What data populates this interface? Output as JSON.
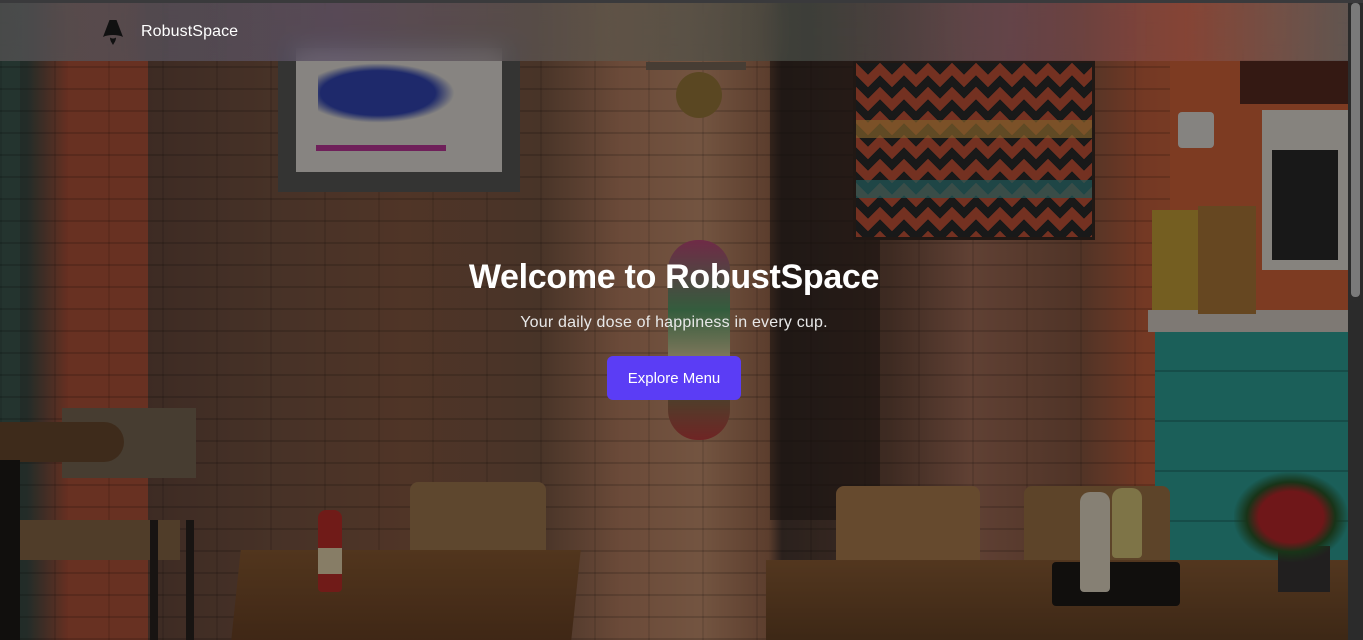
{
  "navbar": {
    "brand_name": "RobustSpace",
    "logo_icon": "astro-logo-icon"
  },
  "hero": {
    "title": "Welcome to RobustSpace",
    "subtitle": "Your daily dose of happiness in every cup.",
    "cta_label": "Explore Menu",
    "background": "cafe-interior-photo"
  },
  "colors": {
    "accent": "#5b3df5",
    "text": "#ffffff"
  }
}
